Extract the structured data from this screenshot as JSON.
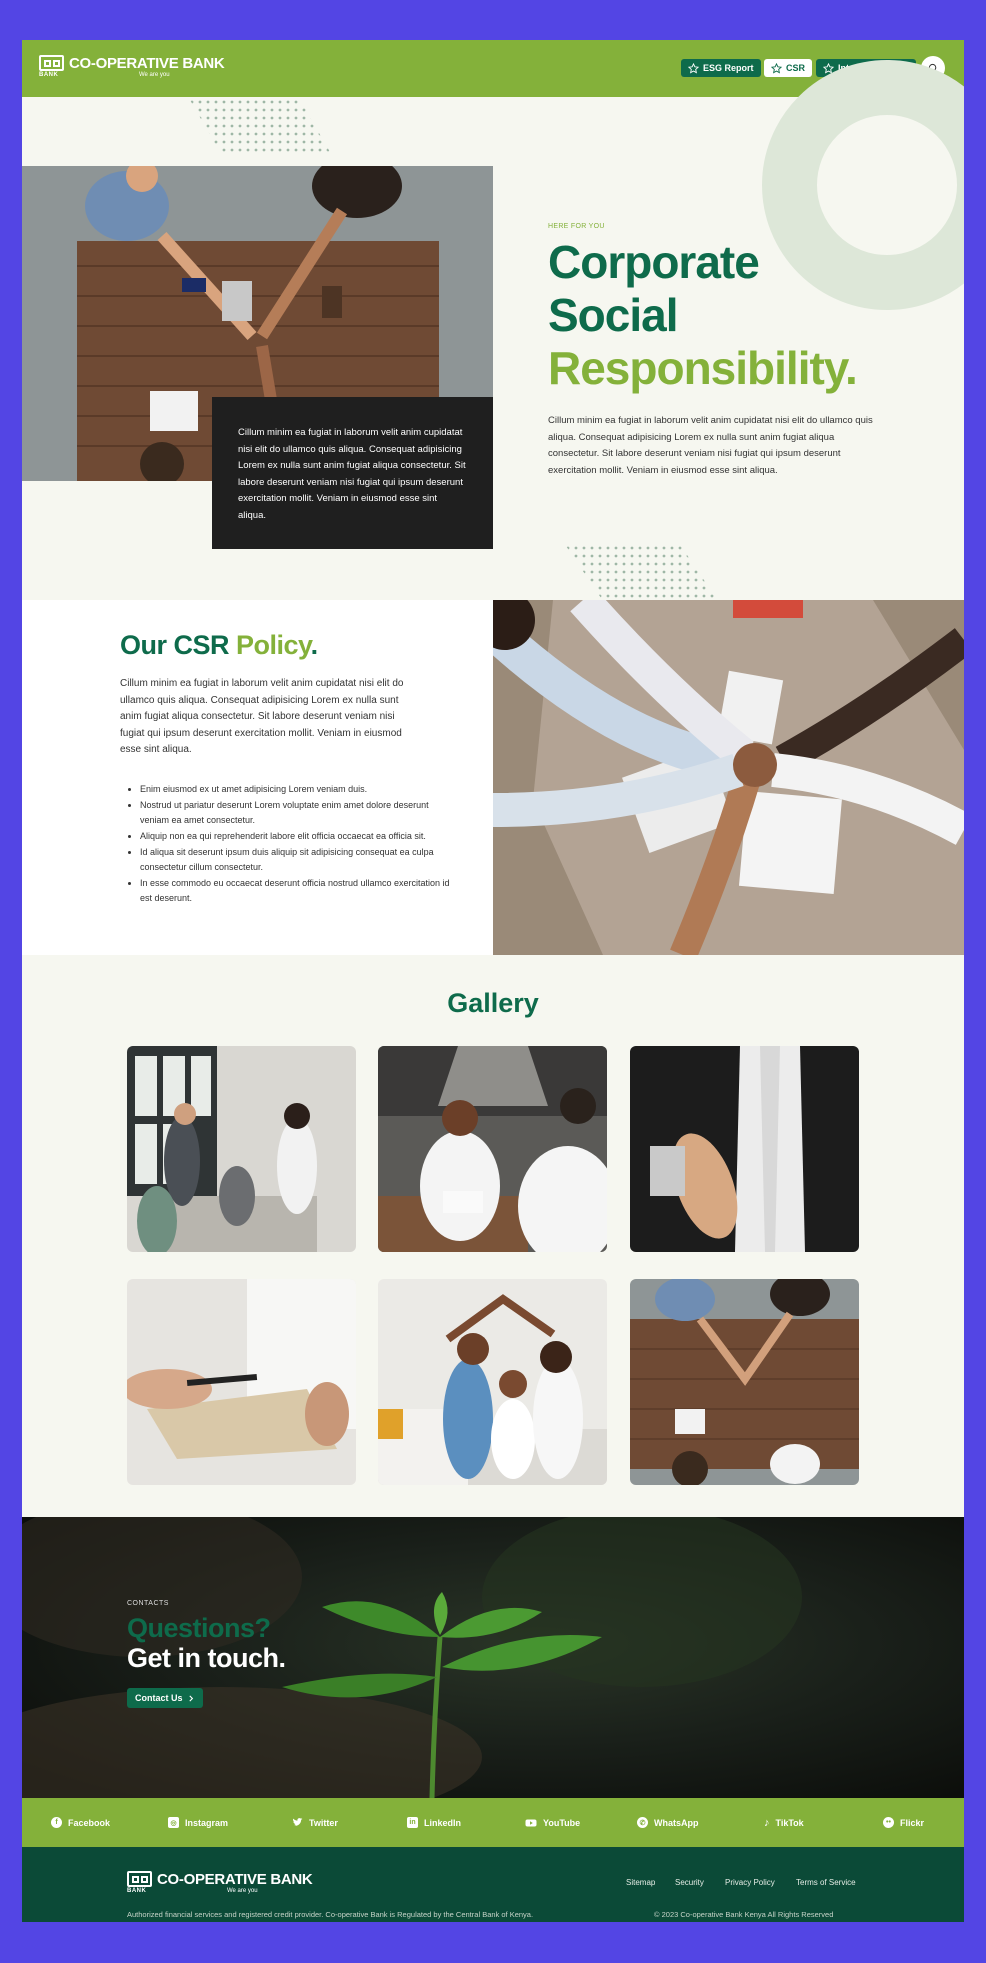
{
  "header": {
    "logo_small": "BANK",
    "logo_name": "CO-OPERATIVE BANK",
    "logo_tagline": "We are you",
    "buttons": {
      "esg": "ESG Report",
      "csr": "CSR",
      "internet_banking": "Internet Banking"
    }
  },
  "hero": {
    "eyebrow": "HERE FOR YOU",
    "title_line1": "Corporate",
    "title_line2": "Social",
    "title_line3": "Responsibility.",
    "text": "Cillum minim ea fugiat in laborum velit anim cupidatat nisi elit do ullamco quis aliqua. Consequat adipisicing Lorem ex nulla sunt anim fugiat aliqua consectetur. Sit labore deserunt veniam nisi fugiat qui ipsum deserunt exercitation mollit. Veniam in eiusmod esse sint aliqua.",
    "card_text": "Cillum minim ea fugiat in laborum velit anim cupidatat nisi elit do ullamco quis aliqua. Consequat adipisicing Lorem ex nulla sunt anim fugiat aliqua consectetur. Sit labore deserunt veniam nisi fugiat qui ipsum deserunt exercitation mollit. Veniam in eiusmod esse sint aliqua."
  },
  "policy": {
    "title_a": "Our CSR ",
    "title_b": "Policy",
    "title_dot": ".",
    "text": "Cillum minim ea fugiat in laborum velit anim cupidatat nisi elit do ullamco quis aliqua. Consequat adipisicing Lorem ex nulla sunt anim fugiat aliqua consectetur. Sit labore deserunt veniam nisi fugiat qui ipsum deserunt exercitation mollit. Veniam in eiusmod esse sint aliqua.",
    "items": [
      "Enim eiusmod ex ut amet adipisicing Lorem veniam duis.",
      "Nostrud ut pariatur deserunt Lorem voluptate enim amet dolore deserunt veniam ea amet consectetur.",
      "Aliquip non ea qui reprehenderit labore elit officia occaecat ea officia sit.",
      "Id aliqua sit deserunt ipsum duis aliquip sit adipisicing consequat ea culpa consectetur cillum consectetur.",
      "In esse commodo eu occaecat deserunt officia nostrud ullamco exercitation id est deserunt."
    ]
  },
  "gallery": {
    "title": "Gallery"
  },
  "contact": {
    "label": "CONTACTS",
    "question": "Questions?",
    "cta": "Get in touch.",
    "button": "Contact Us"
  },
  "social": [
    "Facebook",
    "Instagram",
    "Twitter",
    "LinkedIn",
    "YouTube",
    "WhatsApp",
    "TikTok",
    "Flickr"
  ],
  "footer": {
    "links": [
      "Sitemap",
      "Security",
      "Privacy Policy",
      "Terms of Service"
    ],
    "disclaimer": "Authorized financial services and registered credit provider. Co-operative Bank is Regulated by the Central Bank of Kenya.",
    "copyright": "© 2023 Co-operative Bank Kenya All Rights Reserved"
  },
  "colors": {
    "brand_green": "#84b13a",
    "dark_green": "#0e6b4b",
    "footer_green": "#0b4a37",
    "page_border": "#5345e4"
  }
}
